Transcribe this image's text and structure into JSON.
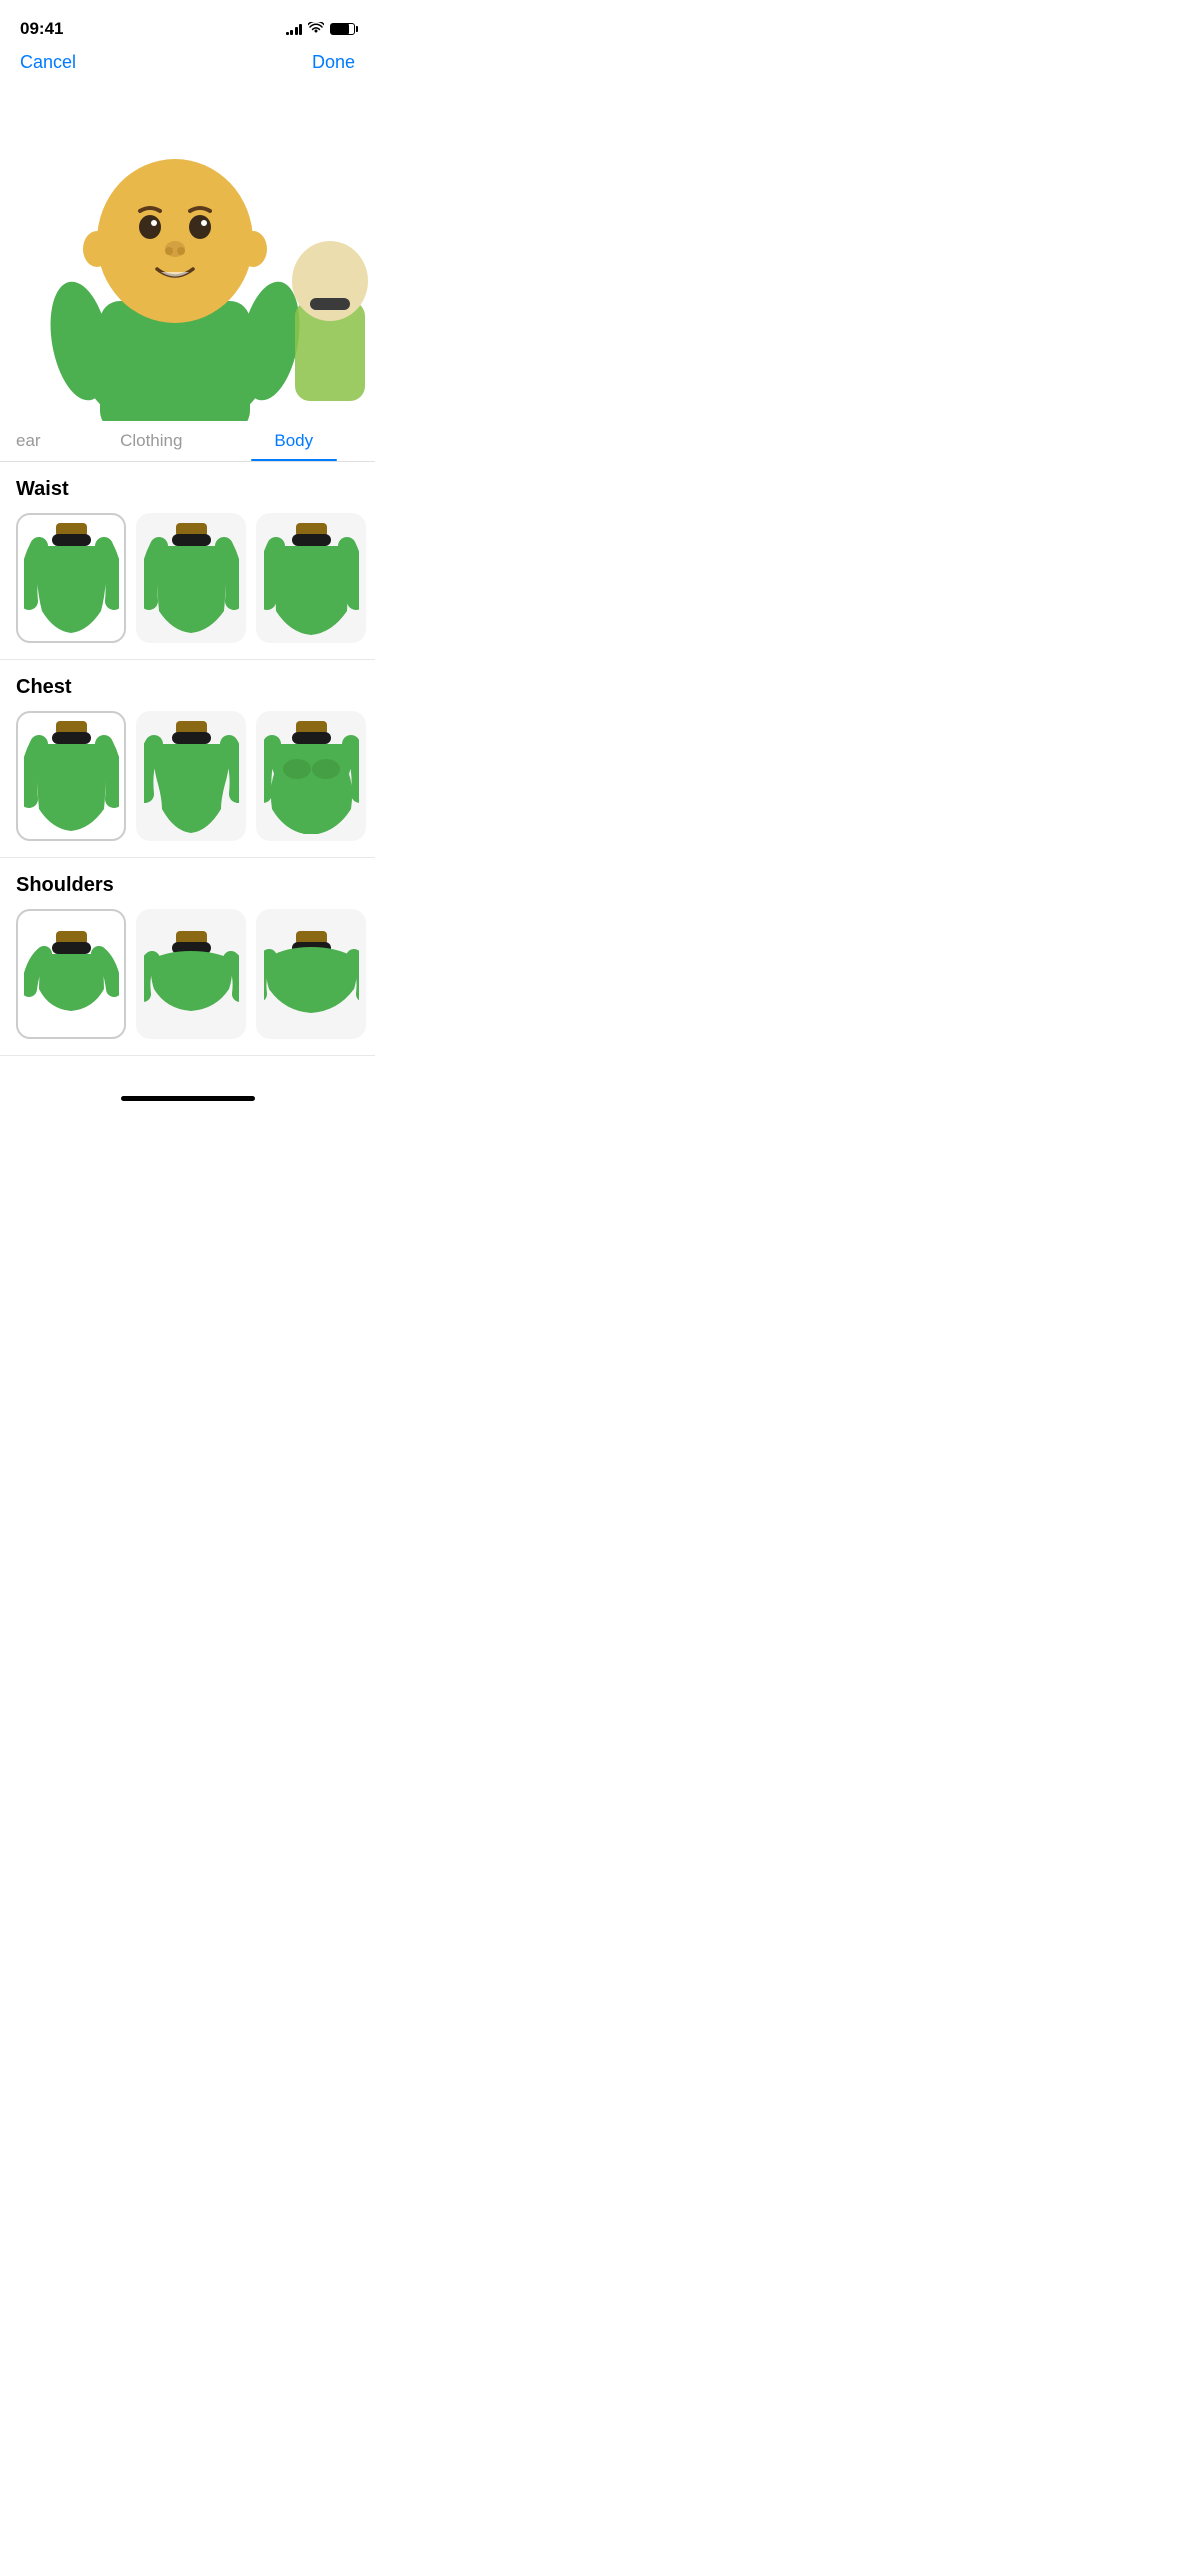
{
  "statusBar": {
    "time": "09:41",
    "signalBars": [
      3,
      5,
      7,
      9,
      11
    ],
    "battery": 80
  },
  "nav": {
    "cancelLabel": "Cancel",
    "doneLabel": "Done"
  },
  "tabs": [
    {
      "id": "headwear",
      "label": "ear",
      "state": "partial"
    },
    {
      "id": "clothing",
      "label": "Clothing",
      "state": "inactive"
    },
    {
      "id": "body",
      "label": "Body",
      "state": "active"
    }
  ],
  "sections": [
    {
      "id": "waist",
      "title": "Waist",
      "options": [
        {
          "id": "waist-1",
          "selected": true
        },
        {
          "id": "waist-2",
          "selected": false
        },
        {
          "id": "waist-3",
          "selected": false
        }
      ]
    },
    {
      "id": "chest",
      "title": "Chest",
      "options": [
        {
          "id": "chest-1",
          "selected": true
        },
        {
          "id": "chest-2",
          "selected": false
        },
        {
          "id": "chest-3",
          "selected": false
        }
      ]
    },
    {
      "id": "shoulders",
      "title": "Shoulders",
      "options": [
        {
          "id": "shoulders-1",
          "selected": true
        },
        {
          "id": "shoulders-2",
          "selected": false
        },
        {
          "id": "shoulders-3",
          "selected": false
        }
      ]
    }
  ],
  "colors": {
    "accent": "#007AFF",
    "green": "#4CAF50",
    "darkGreen": "#3d9940",
    "lightGreen": "#7ecb7e",
    "skinTone": "#E8B84B",
    "collar": "#2a2a2a",
    "neckBand": "#8B6914"
  }
}
